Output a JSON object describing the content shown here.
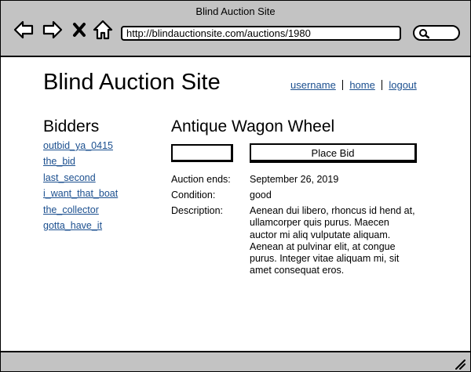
{
  "window": {
    "title": "Blind Auction Site"
  },
  "browser": {
    "url": "http://blindauctionsite.com/auctions/1980"
  },
  "header": {
    "site_title": "Blind Auction Site",
    "links": [
      "username",
      "home",
      "logout"
    ]
  },
  "bidders": {
    "heading": "Bidders",
    "items": [
      "outbid_ya_0415",
      "the_bid",
      "last_second",
      "i_want_that_boat",
      "the_collector",
      "gotta_have_it"
    ]
  },
  "auction": {
    "item_title": "Antique Wagon Wheel",
    "bid_input_value": "",
    "place_bid_label": "Place Bid",
    "fields": {
      "ends_label": "Auction ends:",
      "ends_value": "September 26, 2019",
      "condition_label": "Condition:",
      "condition_value": "good",
      "description_label": "Description:",
      "description_value": "Aenean dui libero, rhoncus id hend at, ullamcorper quis purus. Maecen auctor mi aliq vulputate aliquam. Aenean at pulvinar elit, at congue purus. Integer vitae aliquam mi, sit amet consequat eros."
    }
  },
  "icons": [
    "back-arrow-icon",
    "forward-arrow-icon",
    "close-icon",
    "home-icon",
    "search-icon",
    "resize-grip-icon"
  ]
}
